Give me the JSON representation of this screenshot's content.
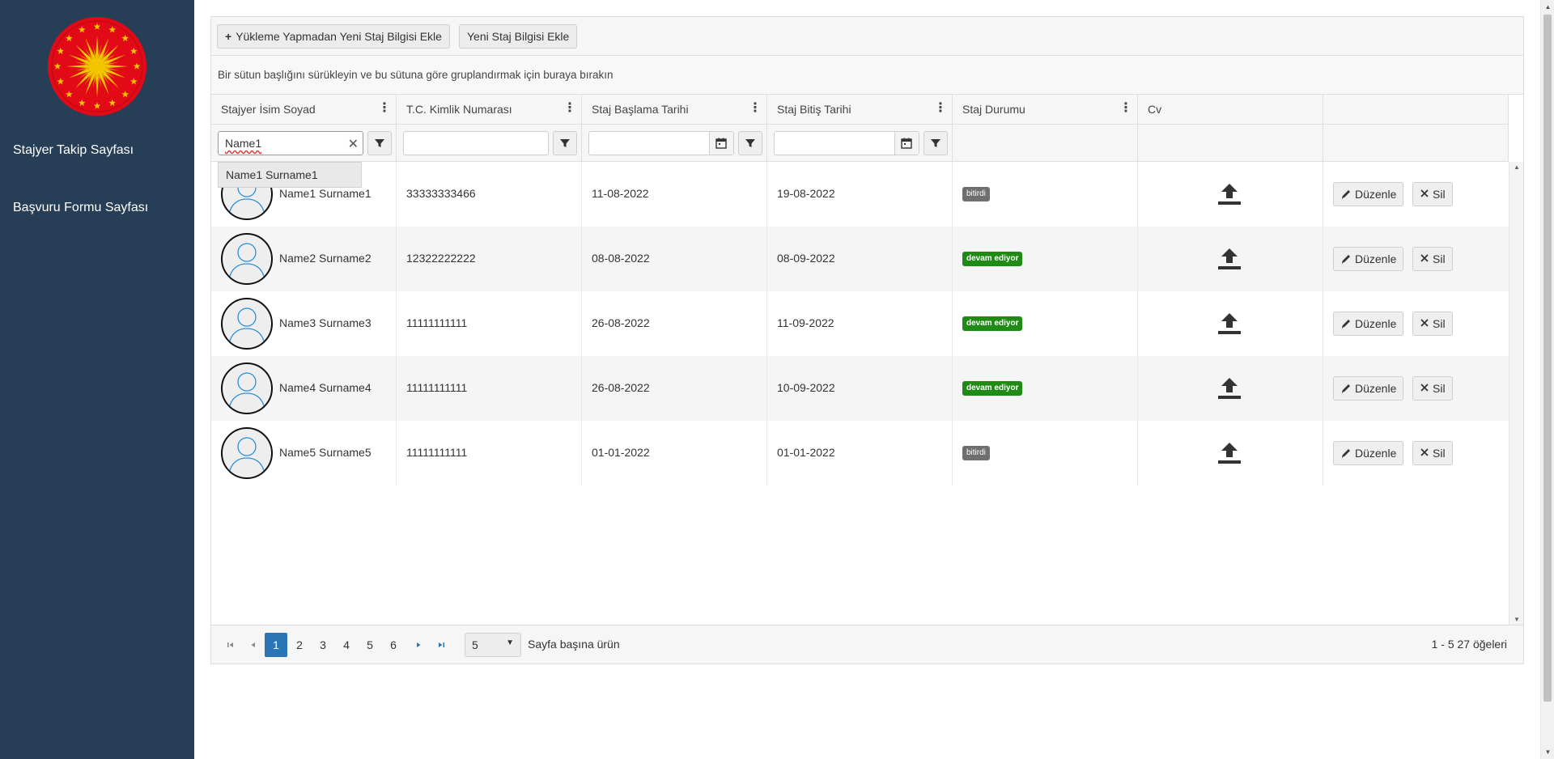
{
  "sidebar": {
    "logo": "presidential-seal",
    "items": [
      {
        "label": "Stajyer Takip Sayfası"
      },
      {
        "label": "Başvuru Formu Sayfası"
      }
    ]
  },
  "toolbar": {
    "add_without_upload_label": "Yükleme Yapmadan Yeni Staj Bilgisi Ekle",
    "add_label": "Yeni Staj Bilgisi Ekle"
  },
  "group_hint": "Bir sütun başlığını sürükleyin ve bu sütuna göre gruplandırmak için buraya bırakın",
  "columns": [
    {
      "title": "Stajyer İsim Soyad"
    },
    {
      "title": "T.C. Kimlik Numarası"
    },
    {
      "title": "Staj Başlama Tarihi"
    },
    {
      "title": "Staj Bitiş Tarihi"
    },
    {
      "title": "Staj Durumu"
    },
    {
      "title": "Cv"
    },
    {
      "title": ""
    }
  ],
  "filters": {
    "name_value": "Name1",
    "name_suggestion": "Name1 Surname1",
    "tc_value": "",
    "start_value": "",
    "end_value": ""
  },
  "rows": [
    {
      "name": "Name1 Surname1",
      "tc": "33333333466",
      "start": "11-08-2022",
      "end": "19-08-2022",
      "status": "bitirdi",
      "status_type": "done"
    },
    {
      "name": "Name2 Surname2",
      "tc": "12322222222",
      "start": "08-08-2022",
      "end": "08-09-2022",
      "status": "devam ediyor",
      "status_type": "ongoing"
    },
    {
      "name": "Name3 Surname3",
      "tc": "11111111111",
      "start": "26-08-2022",
      "end": "11-09-2022",
      "status": "devam ediyor",
      "status_type": "ongoing"
    },
    {
      "name": "Name4 Surname4",
      "tc": "11111111111",
      "start": "26-08-2022",
      "end": "10-09-2022",
      "status": "devam ediyor",
      "status_type": "ongoing"
    },
    {
      "name": "Name5 Surname5",
      "tc": "11111111111",
      "start": "01-01-2022",
      "end": "01-01-2022",
      "status": "bitirdi",
      "status_type": "done"
    }
  ],
  "actions": {
    "edit_label": "Düzenle",
    "delete_label": "Sil"
  },
  "pager": {
    "pages": [
      "1",
      "2",
      "3",
      "4",
      "5",
      "6"
    ],
    "current_page": "1",
    "page_size": "5",
    "page_size_label": "Sayfa başına ürün",
    "info": "1 - 5 27 öğeleri"
  },
  "colors": {
    "sidebar_bg": "#273e57",
    "active_page": "#2a75b3",
    "status_done": "#6f6f6f",
    "status_ongoing": "#1f8a14"
  }
}
